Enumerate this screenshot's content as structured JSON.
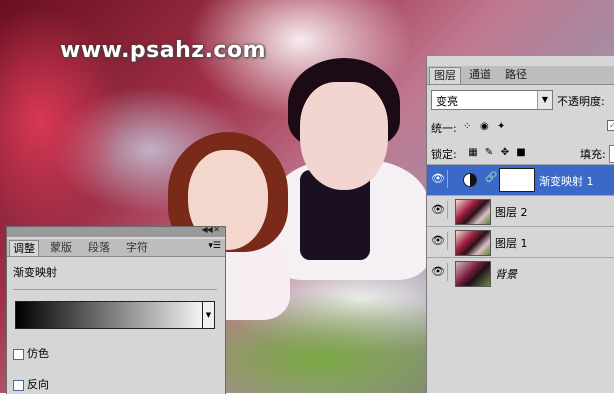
{
  "watermark": "www.psahz.com",
  "layers_panel": {
    "tabs": [
      "图层",
      "通道",
      "路径"
    ],
    "blend_mode": "变亮",
    "opacity_label": "不透明度:",
    "unify_label": "统一:",
    "lock_label": "锁定:",
    "fill_label": "填充:",
    "layers": [
      {
        "name": "渐变映射 1",
        "selected": true,
        "type": "adjustment"
      },
      {
        "name": "图层 2",
        "selected": false,
        "type": "pixel"
      },
      {
        "name": "图层 1",
        "selected": false,
        "type": "pixel"
      },
      {
        "name": "背景",
        "selected": false,
        "type": "background"
      }
    ]
  },
  "adjust_panel": {
    "tabs": [
      "调整",
      "蒙版",
      "段落",
      "字符"
    ],
    "title": "渐变映射",
    "options": [
      "仿色",
      "反向"
    ],
    "gradient_colors": [
      "#000000",
      "#ffffff"
    ]
  },
  "icons": {
    "collapse": "collapse-arrows-icon",
    "close": "close-icon",
    "menu": "panel-menu-icon",
    "eye": "eye-icon",
    "link": "link-icon",
    "adjustment": "gradient-map-icon"
  }
}
